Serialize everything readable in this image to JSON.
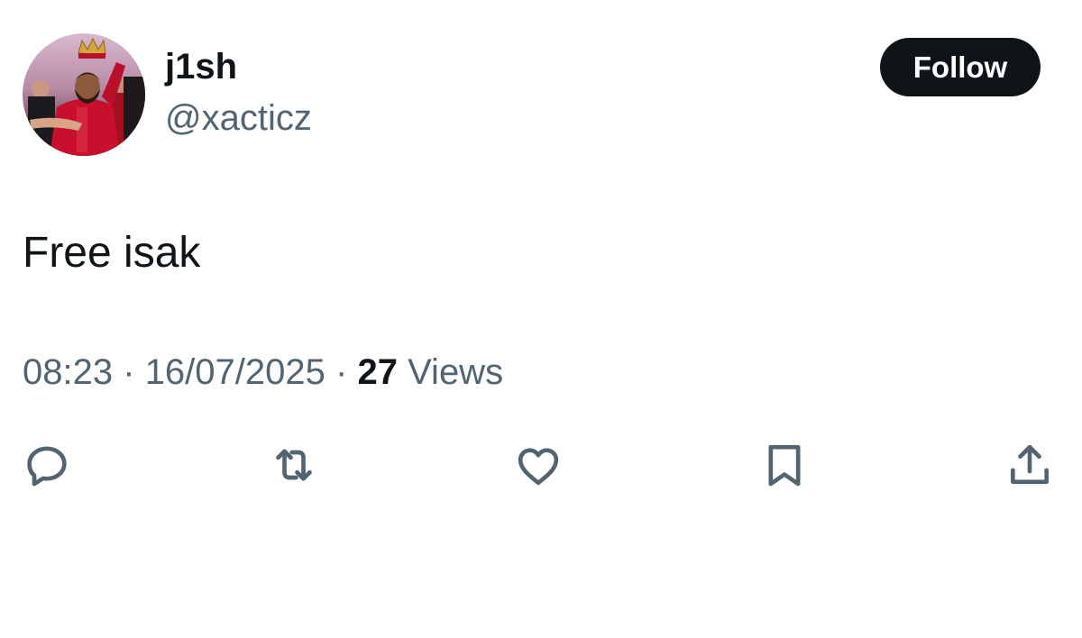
{
  "tweet": {
    "author": {
      "display_name": "j1sh",
      "handle": "@xacticz"
    },
    "follow_label": "Follow",
    "text": "Free isak",
    "time": "08:23",
    "separator": "·",
    "date": "16/07/2025",
    "views_count": "27",
    "views_label": "Views"
  },
  "actions": [
    {
      "name": "reply",
      "icon": "reply-icon"
    },
    {
      "name": "retweet",
      "icon": "retweet-icon"
    },
    {
      "name": "like",
      "icon": "heart-icon"
    },
    {
      "name": "bookmark",
      "icon": "bookmark-icon"
    },
    {
      "name": "share",
      "icon": "share-icon"
    }
  ],
  "colors": {
    "text_primary": "#0f1419",
    "text_secondary": "#536471",
    "follow_button_bg": "#0f1419",
    "follow_button_text": "#ffffff",
    "avatar_jersey": "#c8102e"
  }
}
